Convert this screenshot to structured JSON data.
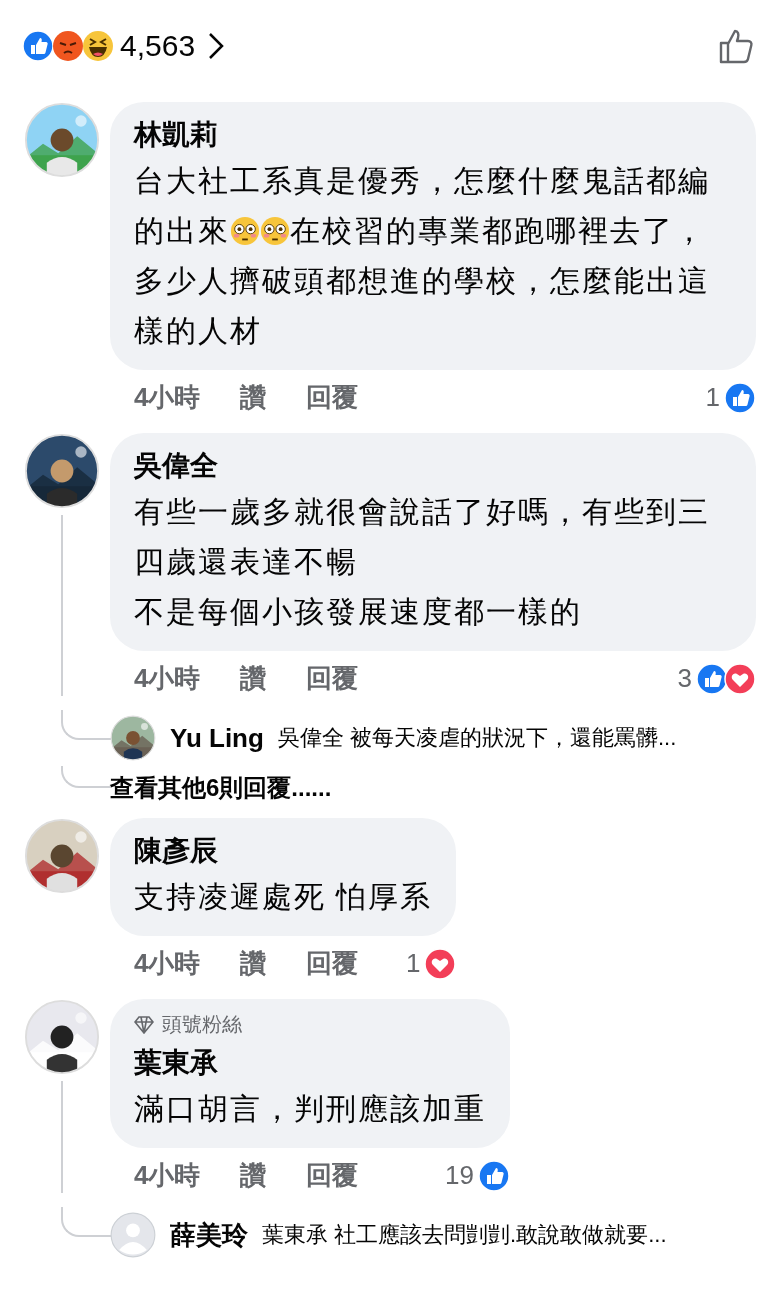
{
  "reaction_summary": {
    "reactions": [
      {
        "kind": "like"
      },
      {
        "kind": "angry"
      },
      {
        "kind": "haha"
      }
    ],
    "count": "4,563"
  },
  "comments": [
    {
      "avatar": {
        "kind": "picture"
      },
      "name": "林凱莉",
      "body": [
        {
          "kind": "text",
          "text": "台大社工系真是優秀，怎麼什麼鬼話都編的出來"
        },
        {
          "kind": "flushed-emoji"
        },
        {
          "kind": "flushed-emoji"
        },
        {
          "kind": "text",
          "text": "在校習的專業都跑哪裡去了，多少人擠破頭都想進的學校，怎麼能出這樣的人材"
        }
      ],
      "time": "4小時",
      "actions": [
        "讚",
        "回覆"
      ],
      "reaction_count": "1",
      "reactions": [
        {
          "kind": "like"
        }
      ]
    },
    {
      "avatar": {
        "kind": "picture"
      },
      "name": "吳偉全",
      "body": [
        {
          "kind": "text",
          "text": "有些一歲多就很會說話了好嗎，有些到三四歲還表達不暢"
        },
        {
          "kind": "line-break"
        },
        {
          "kind": "text",
          "text": "不是每個小孩發展速度都一樣的"
        }
      ],
      "time": "4小時",
      "actions": [
        "讚",
        "回覆"
      ],
      "reaction_count": "3",
      "reactions": [
        {
          "kind": "like"
        },
        {
          "kind": "love"
        }
      ],
      "replies": [
        {
          "avatar": {
            "kind": "picture"
          },
          "name": "Yu Ling",
          "text": "吳偉全 被每天凌虐的狀況下，還能罵髒..."
        }
      ],
      "more_replies": "查看其他6則回覆......"
    },
    {
      "avatar": {
        "kind": "picture"
      },
      "name": "陳彥辰",
      "body": [
        {
          "kind": "text",
          "text": "支持凌遲處死 怕厚系"
        }
      ],
      "time": "4小時",
      "actions": [
        "讚",
        "回覆"
      ],
      "reaction_count": "1",
      "reactions": [
        {
          "kind": "love"
        }
      ]
    },
    {
      "avatar": {
        "kind": "picture"
      },
      "badge": "頭號粉絲",
      "name": "葉東承",
      "body": [
        {
          "kind": "text",
          "text": "滿口胡言，判刑應該加重"
        }
      ],
      "time": "4小時",
      "actions": [
        "讚",
        "回覆"
      ],
      "reaction_count": "19",
      "reactions": [
        {
          "kind": "like"
        }
      ],
      "replies": [
        {
          "avatar": {
            "kind": "default"
          },
          "name": "薛美玲",
          "text": "葉東承 社工應該去問剴剴.敢說敢做就要..."
        }
      ]
    }
  ]
}
